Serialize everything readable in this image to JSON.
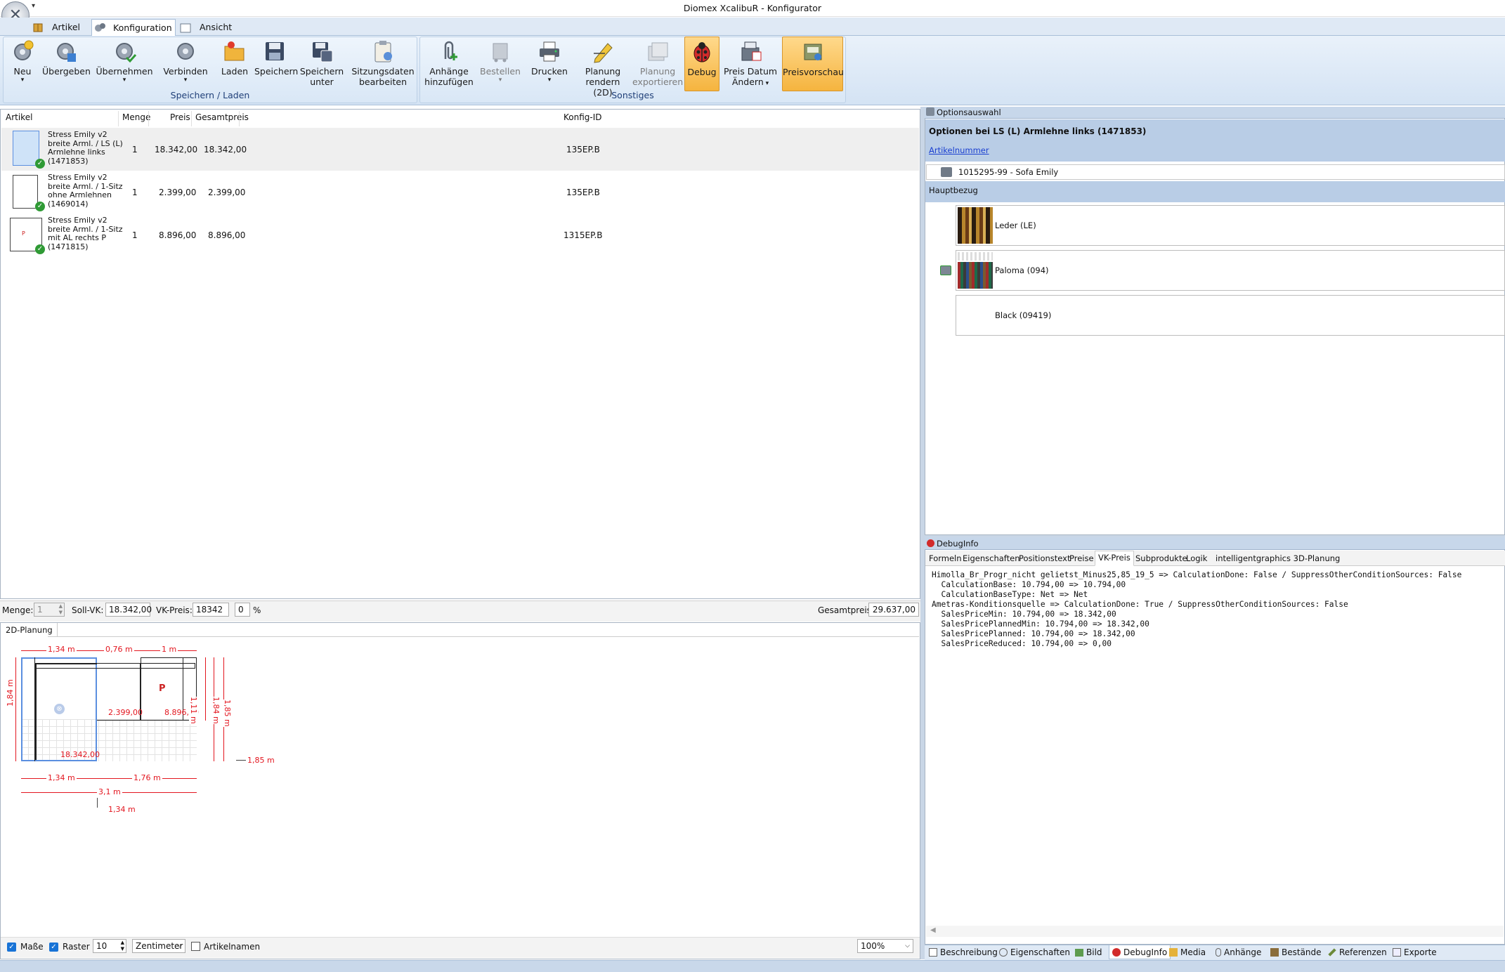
{
  "app": {
    "title": "Diomex XcalibuR - Konfigurator",
    "quick_access": "▾"
  },
  "tabs": [
    "Artikel",
    "Konfiguration",
    "Ansicht"
  ],
  "ribbon": {
    "buttons": [
      {
        "label": "Neu",
        "icon": "gear-new-icon",
        "dropdown": true
      },
      {
        "label": "Übergeben",
        "icon": "gear-transfer-icon"
      },
      {
        "label": "Übernehmen",
        "icon": "gear-accept-icon",
        "dropdown": true
      },
      {
        "label": "Verbinden",
        "icon": "gear-connect-icon",
        "dropdown": true
      },
      {
        "label": "Laden",
        "icon": "folder-open-icon"
      },
      {
        "label": "Speichern",
        "icon": "floppy-disk-icon"
      },
      {
        "label": "Speichern\nunter",
        "icon": "floppy-save-as-icon"
      },
      {
        "label": "Sitzungsdaten\nbearbeiten",
        "icon": "clipboard-edit-icon"
      },
      {
        "label": "Anhänge\nhinzufügen",
        "icon": "paperclip-add-icon"
      },
      {
        "label": "Bestellen",
        "icon": "cart-icon",
        "dropdown": true,
        "disabled": true
      },
      {
        "label": "Drucken",
        "icon": "printer-icon",
        "dropdown": true
      },
      {
        "label": "Planung\nrendern (2D)",
        "icon": "pencil-render-icon"
      },
      {
        "label": "Planung\nexportieren",
        "icon": "export-stack-icon",
        "disabled": true
      },
      {
        "label": "Debug",
        "icon": "ladybug-icon",
        "active": true
      },
      {
        "label": "Preis Datum\nÄndern",
        "icon": "cash-register-icon",
        "dropdown": true
      },
      {
        "label": "Preisvorschau",
        "icon": "price-preview-icon",
        "active": true
      }
    ],
    "groups": [
      "Speichern / Laden",
      "Sonstiges"
    ]
  },
  "article_table": {
    "headers": [
      "Artikel",
      "Menge",
      "Preis",
      "Gesamtpreis",
      "Konfig-ID"
    ],
    "rows": [
      {
        "desc": "Stress Emily v2\nbreite Arml. / LS (L)\nArmlehne links\n(1471853)",
        "qty": "1",
        "price": "18.342,00",
        "total": "18.342,00",
        "config_id": "135EP.B",
        "selected": true
      },
      {
        "desc": "Stress Emily v2\nbreite Arml. / 1-Sitz\nohne Armlehnen\n(1469014)",
        "qty": "1",
        "price": "2.399,00",
        "total": "2.399,00",
        "config_id": "135EP.B"
      },
      {
        "desc": "Stress Emily v2\nbreite Arml. / 1-Sitz\nmit AL rechts P\n(1471815)",
        "qty": "1",
        "price": "8.896,00",
        "total": "8.896,00",
        "config_id": "1315EP.B",
        "thumb_letter": "P"
      }
    ]
  },
  "price_bar": {
    "qty_label": "Menge:",
    "qty_value": "1",
    "soll_label": "Soll-VK:",
    "soll_value": "18.342,00",
    "vk_label": "VK-Preis:",
    "vk_value": "18342",
    "pct_value": "0",
    "pct_unit": "%",
    "total_label": "Gesamtpreis:",
    "total_value": "29.637,00"
  },
  "planning": {
    "tab": "2D-Planung",
    "dims": {
      "top1": "1,34 m",
      "top2": "0,76 m",
      "top3": "1 m",
      "left": "1,84 m",
      "right1": "1,11 m",
      "right2": "1,84 m",
      "right3": "1,85 m",
      "right_bottom": "1,85 m",
      "bot1": "1,34 m",
      "bot2": "1,76 m",
      "total": "3,1 m",
      "depth": "1,34 m"
    },
    "prices": [
      "18.342,00",
      "2.399,00",
      "8.896,00"
    ],
    "letter": "P",
    "footer": {
      "masse": "Maße",
      "raster": "Raster",
      "raster_value": "10",
      "unit": "Zentimeter",
      "artikelnamen": "Artikelnamen",
      "zoom": "100%"
    }
  },
  "options": {
    "panel_title": "Optionsauswahl",
    "heading": "Optionen bei LS (L) Armlehne links (1471853)",
    "link": "Artikelnummer",
    "article": "1015295-99 - Sofa Emily",
    "section": "Hauptbezug",
    "items": [
      "Leder (LE)",
      "Paloma (094)",
      "Black (09419)"
    ]
  },
  "debug": {
    "panel_title": "DebugInfo",
    "tabs": [
      "Formeln",
      "Eigenschaften",
      "Positionstext",
      "Preise",
      "VK-Preis",
      "Subprodukte",
      "Logik",
      "intelligentgraphics 3D-Planung"
    ],
    "active_tab": "VK-Preis",
    "lines": [
      "Himolla_Br_Progr_nicht gelietst_Minus25,85_19_5 => CalculationDone: False / SuppressOtherConditionSources: False",
      "  CalculationBase: 10.794,00 => 10.794,00",
      "  CalculationBaseType: Net => Net",
      "Ametras-Konditionsquelle => CalculationDone: True / SuppressOtherConditionSources: False",
      "  SalesPriceMin: 10.794,00 => 18.342,00",
      "  SalesPricePlannedMin: 10.794,00 => 18.342,00",
      "  SalesPricePlanned: 10.794,00 => 18.342,00",
      "  SalesPriceReduced: 10.794,00 => 0,00"
    ]
  },
  "bottom_tabs": [
    "Beschreibung",
    "Eigenschaften",
    "Bild",
    "DebugInfo",
    "Media",
    "Anhänge",
    "Bestände",
    "Referenzen",
    "Exporte"
  ],
  "colors": {
    "ribbon_bg": "#dbe8f6",
    "active_button": "#f5b43f",
    "panel_header": "#b9cde6",
    "dim_red": "#e3161f",
    "selection": "#5b8fe0"
  }
}
